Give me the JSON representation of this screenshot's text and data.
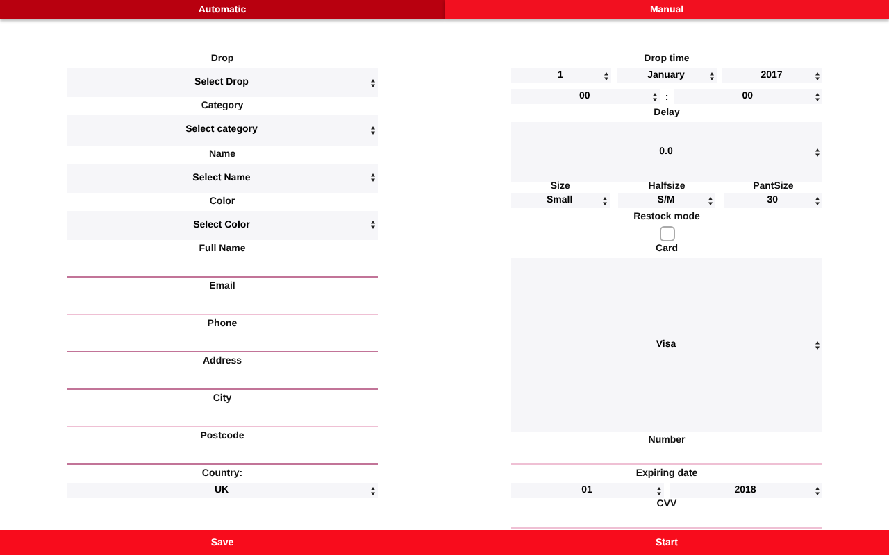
{
  "tabs": [
    {
      "label": "Automatic",
      "selected": true
    },
    {
      "label": "Manual",
      "selected": false
    }
  ],
  "automatic": {
    "selects": [
      {
        "label": "Drop",
        "value": "Select Drop"
      },
      {
        "label": "Category",
        "value": "Select category"
      },
      {
        "label": "Name",
        "value": "Select Name"
      },
      {
        "label": "Color",
        "value": "Select Color"
      }
    ],
    "fields": [
      {
        "label": "Full Name"
      },
      {
        "label": "Email"
      },
      {
        "label": "Phone"
      },
      {
        "label": "Address"
      },
      {
        "label": "City"
      },
      {
        "label": "Postcode"
      }
    ],
    "country": {
      "label": "Country:",
      "value": "UK"
    },
    "button": "Save"
  },
  "manual": {
    "drop_time": {
      "label": "Drop time",
      "day": "1",
      "month": "January",
      "year": "2017",
      "hour": "00",
      "separator": ":",
      "minute": "00"
    },
    "delay": {
      "label": "Delay",
      "value": "0.0"
    },
    "sizes": [
      {
        "label": "Size",
        "value": "Small"
      },
      {
        "label": "Halfsize",
        "value": "S/M"
      },
      {
        "label": "PantSize",
        "value": "30"
      }
    ],
    "restock": {
      "label": "Restock mode",
      "checked": false
    },
    "card": {
      "label": "Card",
      "value": "Visa"
    },
    "number": {
      "label": "Number"
    },
    "expiry": {
      "label": "Expiring date",
      "month": "01",
      "year": "2018"
    },
    "cvv": {
      "label": "CVV"
    },
    "button": "Start"
  }
}
